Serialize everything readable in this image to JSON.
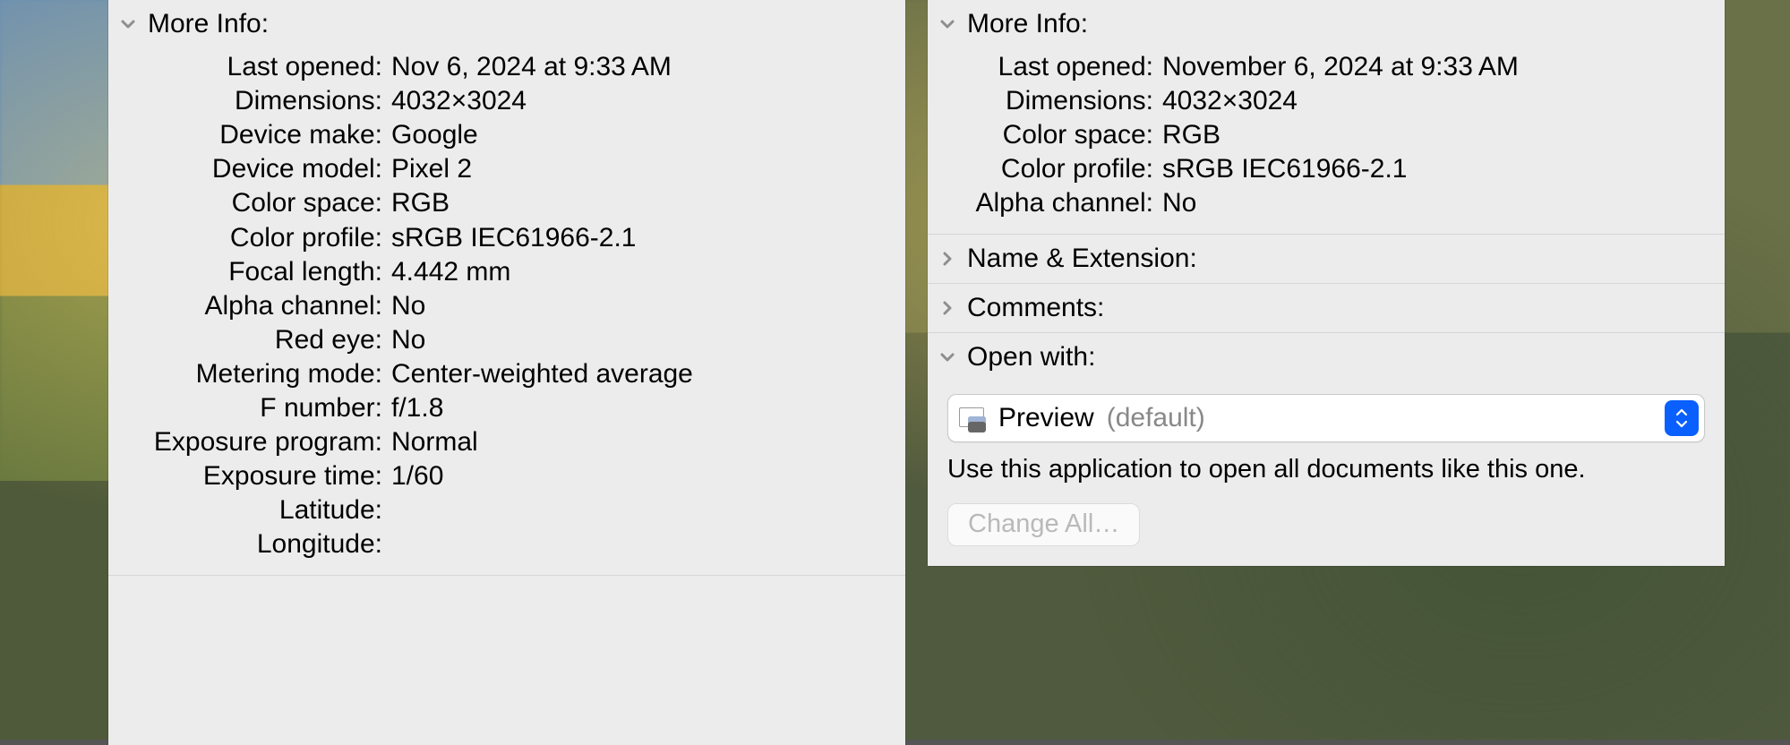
{
  "left": {
    "more_info_title": "More Info:",
    "fields": {
      "last_opened": {
        "label": "Last opened:",
        "value": "Nov 6, 2024 at 9:33 AM"
      },
      "dimensions": {
        "label": "Dimensions:",
        "value": "4032×3024"
      },
      "device_make": {
        "label": "Device make:",
        "value": "Google"
      },
      "device_model": {
        "label": "Device model:",
        "value": "Pixel 2"
      },
      "color_space": {
        "label": "Color space:",
        "value": "RGB"
      },
      "color_profile": {
        "label": "Color profile:",
        "value": "sRGB IEC61966-2.1"
      },
      "focal_length": {
        "label": "Focal length:",
        "value": "4.442 mm"
      },
      "alpha_channel": {
        "label": "Alpha channel:",
        "value": "No"
      },
      "red_eye": {
        "label": "Red eye:",
        "value": "No"
      },
      "metering_mode": {
        "label": "Metering mode:",
        "value": "Center-weighted average"
      },
      "f_number": {
        "label": "F number:",
        "value": "f/1.8"
      },
      "exposure_prog": {
        "label": "Exposure program:",
        "value": "Normal"
      },
      "exposure_time": {
        "label": "Exposure time:",
        "value": "1/60"
      },
      "latitude": {
        "label": "Latitude:",
        "value": " "
      },
      "longitude": {
        "label": "Longitude:",
        "value": " "
      }
    }
  },
  "right": {
    "more_info_title": "More Info:",
    "fields": {
      "last_opened": {
        "label": "Last opened:",
        "value": "November 6, 2024 at 9:33 AM"
      },
      "dimensions": {
        "label": "Dimensions:",
        "value": "4032×3024"
      },
      "color_space": {
        "label": "Color space:",
        "value": "RGB"
      },
      "color_profile": {
        "label": "Color profile:",
        "value": "sRGB IEC61966-2.1"
      },
      "alpha_channel": {
        "label": "Alpha channel:",
        "value": "No"
      }
    },
    "name_ext_title": "Name & Extension:",
    "comments_title": "Comments:",
    "open_with_title": "Open with:",
    "open_with_app": "Preview",
    "open_with_default": "(default)",
    "open_with_hint": "Use this application to open all documents like this one.",
    "change_all_label": "Change All…"
  }
}
